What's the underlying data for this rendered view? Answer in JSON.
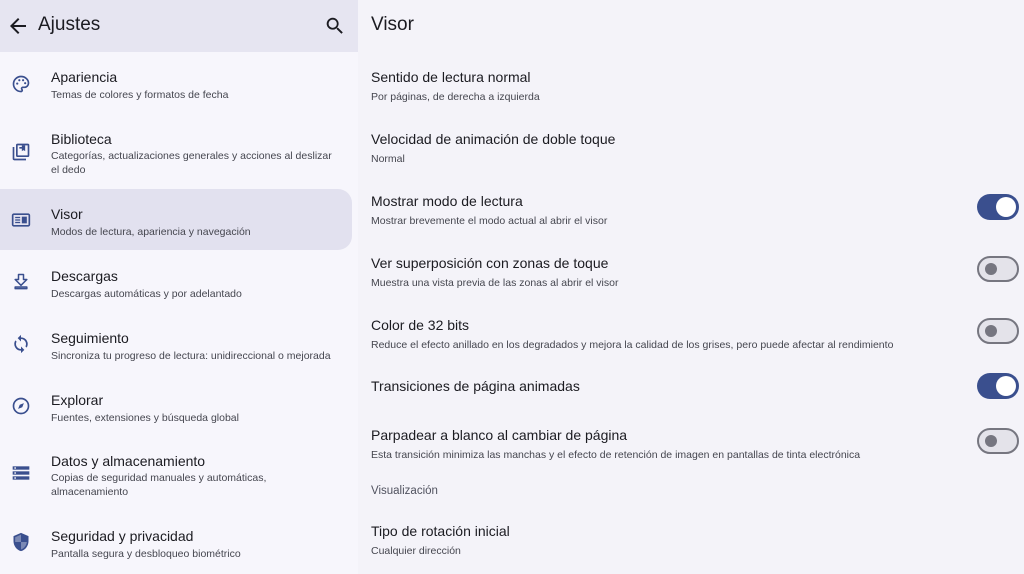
{
  "app": {
    "title": "Ajustes",
    "back_icon": "arrow-back-icon",
    "search_icon": "search-icon"
  },
  "sidebar": {
    "items": [
      {
        "label": "Apariencia",
        "desc": "Temas de colores y formatos de fecha",
        "icon": "palette-icon"
      },
      {
        "label": "Biblioteca",
        "desc": "Categorías, actualizaciones generales y acciones al deslizar el dedo",
        "icon": "library-icon"
      },
      {
        "label": "Visor",
        "desc": "Modos de lectura, apariencia y navegación",
        "icon": "reader-icon",
        "selected": true
      },
      {
        "label": "Descargas",
        "desc": "Descargas automáticas y por adelantado",
        "icon": "download-icon"
      },
      {
        "label": "Seguimiento",
        "desc": "Sincroniza tu progreso de lectura: unidireccional o mejorada",
        "icon": "sync-icon"
      },
      {
        "label": "Explorar",
        "desc": "Fuentes, extensiones y búsqueda global",
        "icon": "compass-icon"
      },
      {
        "label": "Datos y almacenamiento",
        "desc": "Copias de seguridad manuales y automáticas, almacenamiento",
        "icon": "storage-icon"
      },
      {
        "label": "Seguridad y privacidad",
        "desc": "Pantalla segura y desbloqueo biométrico",
        "icon": "shield-icon"
      }
    ]
  },
  "main": {
    "title": "Visor",
    "prefs": [
      {
        "label": "Sentido de lectura normal",
        "desc": "Por páginas, de derecha a izquierda"
      },
      {
        "label": "Velocidad de animación de doble toque",
        "desc": "Normal"
      },
      {
        "label": "Mostrar modo de lectura",
        "desc": "Mostrar brevemente el modo actual al abrir el visor",
        "toggle": true
      },
      {
        "label": "Ver superposición con zonas de toque",
        "desc": "Muestra una vista previa de las zonas al abrir el visor",
        "toggle": false
      },
      {
        "label": "Color de 32 bits",
        "desc": "Reduce el efecto anillado en los degradados y mejora la calidad de los grises, pero puede afectar al rendimiento",
        "toggle": false
      },
      {
        "label": "Transiciones de página animadas",
        "toggle": true
      },
      {
        "label": "Parpadear a blanco al cambiar de página",
        "desc": "Esta transición minimiza las manchas y el efecto de retención de imagen en pantallas de tinta electrónica",
        "toggle": false
      },
      {
        "label": "Tipo de rotación inicial",
        "desc": "Cualquier dirección"
      }
    ],
    "section_header": "Visualización"
  },
  "colors": {
    "accent": "#3a4f8e",
    "selected_bg": "#e2e1ef",
    "topbar_bg": "#e6e5f1"
  }
}
